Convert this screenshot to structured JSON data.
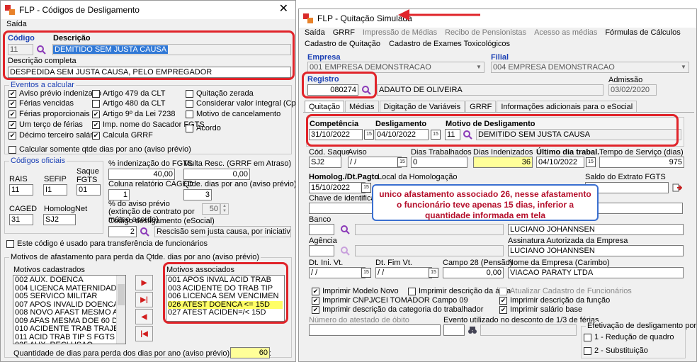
{
  "left": {
    "title": "FLP - Códigos de Desligamento",
    "menu": [
      "Saída"
    ],
    "codigo_label": "Código",
    "codigo_value": "11",
    "descricao_label": "Descrição",
    "descricao_value": "DEMITIDO SEM JUSTA CAUSA",
    "desc_completa_label": "Descrição completa",
    "desc_completa_value": "DESPEDIDA SEM JUSTA CAUSA, PELO EMPREGADOR",
    "eventos_title": "Eventos a calcular",
    "eventos": [
      {
        "label": "Aviso prévio indenizado",
        "checked": true
      },
      {
        "label": "Férias vencidas",
        "checked": true
      },
      {
        "label": "Férias proporcionais",
        "checked": true
      },
      {
        "label": "Um terço de férias",
        "checked": true
      },
      {
        "label": "Décimo terceiro salário",
        "checked": true
      },
      {
        "label": "Artigo 479 da CLT",
        "checked": false
      },
      {
        "label": "Artigo 480 da CLT",
        "checked": false
      },
      {
        "label": "Artigo 9º da Lei 7238",
        "checked": true
      },
      {
        "label": "Imp. nome do Sacador FGTS",
        "checked": true
      },
      {
        "label": "Calcula GRRF",
        "checked": true
      },
      {
        "label": "Quitação zerada",
        "checked": false
      },
      {
        "label": "Considerar valor integral (Cpo 21)",
        "checked": false
      },
      {
        "label": "Motivo de cancelamento",
        "checked": false
      },
      {
        "label": "Acordo",
        "checked": false
      }
    ],
    "calc_somente": "Calcular somente qtde dias por ano (aviso prévio)",
    "codigos_title": "Códigos oficiais",
    "rais_label": "RAIS",
    "rais_value": "11",
    "sefip_label": "SEFIP",
    "sefip_value": "I1",
    "saque_label": "Saque FGTS",
    "saque_value": "01",
    "caged_label": "CAGED",
    "caged_value": "31",
    "homolog_label": "HomologNet",
    "homolog_value": "SJ2",
    "pct_fgts_label": "% indenização do FGTS",
    "pct_fgts_value": "40,00",
    "multa_label": "Multa Resc. (GRRF em Atraso)",
    "multa_value": "0,00",
    "coluna_label": "Coluna relatório CAGED",
    "coluna_value": "1",
    "qtde_label": "Qtde. dias por ano (aviso prévio)",
    "qtde_value": "3",
    "pct_aviso_label": "% do aviso prévio (extinção de contrato por mútuo acordo)",
    "pct_aviso_value": "50",
    "cod_esocial_label": "Código desligamento (eSocial)",
    "cod_esocial_value": "2",
    "cod_esocial_desc": "Rescisão sem justa causa, por iniciativa do emp",
    "transfer_label": "Este código é usado para transferência de funcionários",
    "motivos_group": "Motivos de afastamento para perda da Qtde. dias por ano (aviso prévio)",
    "cadastrados_label": "Motivos cadastrados",
    "cadastrados": [
      "002 AUX. DOENCA",
      "004 LICENCA MATERNIDADE",
      "005 SERVICO MILITAR",
      "007 APOS INVALID DOENCA",
      "008 NOVO AFAST MESMO A T",
      "009 AFAS MESMA DOE 60  D",
      "010 ACIDENTE TRAB TRAJET",
      "011 ACID TRAB TIP S FGTS",
      "025 AUX. RECLUSAO"
    ],
    "associados_label": "Motivos associados",
    "associados": [
      "001 APOS INVAL ACID TRAB",
      "003 ACIDENTE DO TRAB TIP",
      "006 LICENCA SEM VENCIMEN",
      "026 ATEST DOENCA <= 15D",
      "027 ATEST ACIDEN=/< 15D"
    ],
    "quantidade_label": "Quantidade de dias para perda dos dias por ano (aviso prévio) a  partir de :",
    "quantidade_value": "60"
  },
  "right": {
    "title": "FLP - Quitação Simulada",
    "menu1": [
      "Saída",
      "GRRF",
      "Impressão de Médias",
      "Recibo de Pensionistas",
      "Acesso as médias",
      "Fórmulas de Cálculos"
    ],
    "menu2": [
      "Cadastro de Quitação",
      "Cadastro de Exames Toxicológicos"
    ],
    "empresa_label": "Empresa",
    "empresa_value": "001 EMPRESA DEMONSTRACAO",
    "filial_label": "Filial",
    "filial_value": "004 EMPRESA DEMONSTRACAO",
    "registro_label": "Registro",
    "registro_value": "080274",
    "nome_value": "ADAUTO DE OLIVEIRA",
    "admissao_label": "Admissão",
    "admissao_value": "03/02/2020",
    "tabs": [
      "Quitação",
      "Médias",
      "Digitação de Variáveis",
      "GRRF",
      "Informações adicionais para o eSocial"
    ],
    "competencia_label": "Competência",
    "competencia_value": "31/10/2022",
    "desligamento_label": "Desligamento",
    "desligamento_value": "04/10/2022",
    "motivo_label": "Motivo de Desligamento",
    "motivo_code": "11",
    "motivo_desc": "DEMITIDO SEM JUSTA CAUSA",
    "cod_saque_label": "Cód. Saque",
    "cod_saque_value": "SJ2",
    "aviso_label": "Aviso",
    "aviso_value": "/ /",
    "dias_trab_label": "Dias Trabalhados",
    "dias_trab_value": "0",
    "dias_ind_label": "Dias Indenizados",
    "dias_ind_value": "36",
    "ultimo_label": "Último dia trabal.",
    "ultimo_value": "04/10/2022",
    "tempo_label": "Tempo de Serviço (dias)",
    "tempo_value": "975",
    "homolog_label": "Homolog./Dt.Pagto",
    "homolog_value": "15/10/2022",
    "local_label": "Local da Homologação",
    "saldo_label": "Saldo do Extrato FGTS",
    "chave_label": "Chave de identificação",
    "banco_label": "Banco",
    "banco_value": "",
    "agencia_label": "Agência",
    "resp1_value": "LUCIANO JOHANNSEN",
    "assinatura_label": "Assinatura Autorizada da Empresa",
    "assinatura_value": "LUCIANO JOHANNSEN",
    "dt_ini_label": "Dt. Ini. Vt.",
    "dt_ini_value": "/ /",
    "dt_fim_label": "Dt. Fim Vt.",
    "dt_fim_value": "/ /",
    "campo28_label": "Campo 28 (Pensão)",
    "campo28_value": "0,00",
    "nome_empresa_label": "Nome da Empresa (Carimbo)",
    "nome_empresa_value": "VIACAO PARATY LTDA",
    "checks": [
      {
        "label": "Imprimir Modelo Novo",
        "checked": true
      },
      {
        "label": "Imprimir CNPJ/CEI TOMADOR Campo 09",
        "checked": true
      },
      {
        "label": "Imprimir descrição da categoria do trabalhador",
        "checked": true
      },
      {
        "label": "Imprimir descrição da área",
        "checked": false
      },
      {
        "label": "Atualizar Cadastro de Funcionários",
        "checked": false
      },
      {
        "label": "Imprimir descrição da função",
        "checked": true
      },
      {
        "label": "Imprimir salário base",
        "checked": true
      }
    ],
    "atestado_label": "Número do atestado de óbito",
    "evento_label": "Evento utilizado no desconto de 1/3 de férias",
    "efetivacao_label": "Efetivação de desligamento por:",
    "efetivacao_opts": [
      "1 - Redução de quadro",
      "2 - Substituição"
    ],
    "callout": "unico afastamento associado 26, nesse afastamento o funcionário teve apenas 15 dias, inferior a quantidade informada em tela"
  },
  "colors": {
    "annotation_red": "#e0242a",
    "highlight_yellow": "#ffff99",
    "selection_blue": "#3078d6",
    "label_blue": "#1a3fb4"
  }
}
